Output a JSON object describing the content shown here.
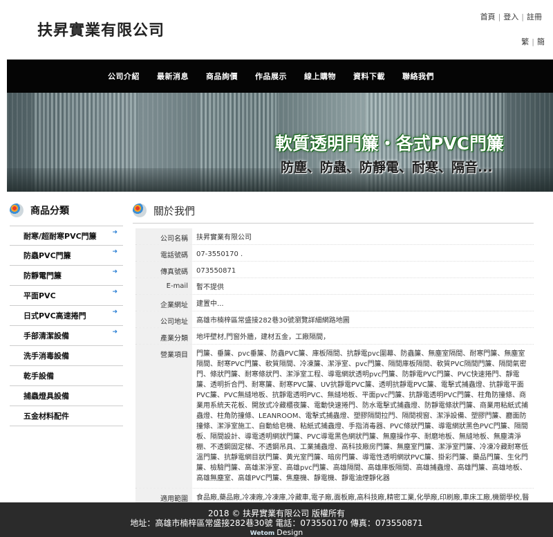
{
  "header": {
    "company_name": "扶昇實業有限公司",
    "top_links": [
      "首頁",
      "登入",
      "註冊"
    ],
    "lang_links": [
      "繁",
      "簡"
    ]
  },
  "nav": {
    "items": [
      "公司介紹",
      "最新消息",
      "商品詢價",
      "作品展示",
      "線上購物",
      "資料下載",
      "聯絡我們"
    ]
  },
  "banner": {
    "headline": "軟質透明門簾・各式PVC門簾",
    "subline": "防塵、防蟲、防靜電、耐寒、隔音..."
  },
  "sidebar": {
    "title": "商品分類",
    "arrow_icon": "arrow-right-icon",
    "items": [
      {
        "label": "耐寒/超耐寒PVC門簾",
        "arrow": true
      },
      {
        "label": "防蟲PVC門簾",
        "arrow": true
      },
      {
        "label": "防靜電門簾",
        "arrow": true
      },
      {
        "label": "平面PVC",
        "arrow": true
      },
      {
        "label": "日式PVC高速捲門",
        "arrow": true
      },
      {
        "label": "手部清潔設備",
        "arrow": true
      },
      {
        "label": "洗手消毒設備",
        "arrow": false
      },
      {
        "label": "乾手設備",
        "arrow": false
      },
      {
        "label": "捕蟲燈具設備",
        "arrow": false
      },
      {
        "label": "五金材料配件",
        "arrow": false
      }
    ]
  },
  "main": {
    "title": "關於我們",
    "rows": [
      {
        "label": "公司名稱",
        "value": "扶昇實業有限公司"
      },
      {
        "label": "電話號碼",
        "value": "07-3550170 ."
      },
      {
        "label": "傳真號碼",
        "value": "073550871"
      },
      {
        "label": "E-mail",
        "value": "暫不提供"
      },
      {
        "label": "企業網址",
        "value": "建置中..."
      },
      {
        "label": "公司地址",
        "value": "高雄市楠梓區常盛接282巷30號瀏覽詳細網路地圖"
      },
      {
        "label": "產業分類",
        "value": "地坪壁材,門窗外牆，建材五金，工廠隔間，"
      },
      {
        "label": "營業項目",
        "value": "門簾、垂簾、pvc垂簾、防蟲PVC簾、庫板隔間、抗靜電pvc圍幕、防蟲簾、無塵室隔間、耐寒門簾、無塵室隔間、耐寒PVC門簾、軟質隔間、冷凍簾、潔淨室、pvc門簾、隔間庫板隔間、軟質PVC隔間門簾、隔間氣密門、條狀門簾、耐寒條狀門、潔淨室工程、導電網狀透明pvc門簾、防靜電PVC門簾、PVC快速捲門、靜電簾、透明折合門、耐寒簾、耐寒PVC簾、UV抗靜電PVC簾、透明抗靜電PVC簾、電擊式捕蟲燈、抗靜電平面PVC簾、PVC無縫地板、抗靜電透明PVC、無縫地板、平面pvc門簾、抗靜電透明PVC門簾、柱角防撞條、商業用系統天花板、開放式冷藏櫃夜簾、電動快速捲門、防水電擊式捕蟲燈、防靜電條狀門簾、商業用粘紙式捕蟲燈、柱角防撞條、LEANROOM、電擊式捕蟲燈、塑膠隔間拉門、隔間視窗、潔淨設備、塑膠門簾、廳面防撞條、潔淨室施工、自動給皂機、粘紙式捕蟲燈、手指消毒器、PVC條狀門簾、導電網狀黑色PVC門簾、隔間板、隔間設計、導電透明網狀門簾、PVC導電黑色網狀門簾、無塵操作亭、耐磨地板、無縫地板、無塵清淨棚、不透鋼固定梯、不透鋼吊具、工業捕蟲燈、高科技廠房門簾、無塵室門簾、潔淨室門簾、冷凍冷藏耐寒低溫門簾、抗靜電網目狀門簾、黃光室門簾、暗房門簾、導電性透明網狀PVC簾、掛彩門簾、藥品門簾、生化門簾、檢驗門簾、高雄潔淨室、高雄pvc門簾、高雄隔間、高雄庫板隔間、高雄捕蟲燈、高雄門簾、高雄地板、高雄無塵室、高雄PVC門簾、焦塵機、靜電機、靜電油煙靜化器"
      },
      {
        "label": "適用範圍",
        "value": "食品廠,藥品廠,冷凍廠,冷凍庫,冷藏車,電子廠,面板廠,高科技廠,精密工業,化學廠,印刷廠,車床工廠,機關學校,醫療機構"
      }
    ]
  },
  "footer": {
    "copyright": "2018 © 扶昇實業有限公司 版權所有",
    "contact": "地址：高雄市楠梓區常盛接282巷30號  電話：073550170 傳真：073550871",
    "brand": "Wetom",
    "design": "Design"
  }
}
